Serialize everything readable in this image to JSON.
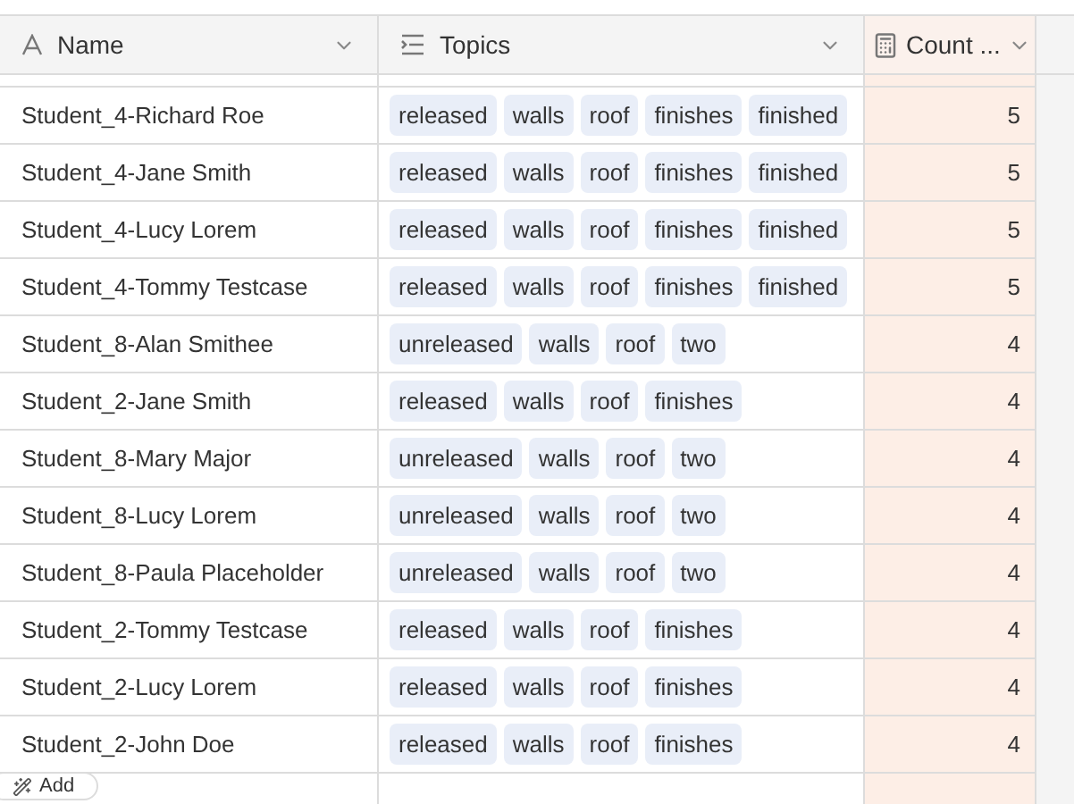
{
  "columns": [
    {
      "kind": "text",
      "label": "Name"
    },
    {
      "kind": "tags",
      "label": "Topics"
    },
    {
      "kind": "count",
      "label": "Count ..."
    }
  ],
  "rows": [
    {
      "name": "Student_4-Richard Roe",
      "topics": [
        "released",
        "walls",
        "roof",
        "finishes",
        "finished"
      ],
      "count": "5"
    },
    {
      "name": "Student_4-Jane Smith",
      "topics": [
        "released",
        "walls",
        "roof",
        "finishes",
        "finished"
      ],
      "count": "5"
    },
    {
      "name": "Student_4-Lucy Lorem",
      "topics": [
        "released",
        "walls",
        "roof",
        "finishes",
        "finished"
      ],
      "count": "5"
    },
    {
      "name": "Student_4-Tommy Testcase",
      "topics": [
        "released",
        "walls",
        "roof",
        "finishes",
        "finished"
      ],
      "count": "5"
    },
    {
      "name": "Student_8-Alan Smithee",
      "topics": [
        "unreleased",
        "walls",
        "roof",
        "two"
      ],
      "count": "4"
    },
    {
      "name": "Student_2-Jane Smith",
      "topics": [
        "released",
        "walls",
        "roof",
        "finishes"
      ],
      "count": "4"
    },
    {
      "name": "Student_8-Mary Major",
      "topics": [
        "unreleased",
        "walls",
        "roof",
        "two"
      ],
      "count": "4"
    },
    {
      "name": "Student_8-Lucy Lorem",
      "topics": [
        "unreleased",
        "walls",
        "roof",
        "two"
      ],
      "count": "4"
    },
    {
      "name": "Student_8-Paula Placeholder",
      "topics": [
        "unreleased",
        "walls",
        "roof",
        "two"
      ],
      "count": "4"
    },
    {
      "name": "Student_2-Tommy Testcase",
      "topics": [
        "released",
        "walls",
        "roof",
        "finishes"
      ],
      "count": "4"
    },
    {
      "name": "Student_2-Lucy Lorem",
      "topics": [
        "released",
        "walls",
        "roof",
        "finishes"
      ],
      "count": "4"
    },
    {
      "name": "Student_2-John Doe",
      "topics": [
        "released",
        "walls",
        "roof",
        "finishes"
      ],
      "count": "4"
    }
  ],
  "add_button": {
    "label": "Add"
  }
}
